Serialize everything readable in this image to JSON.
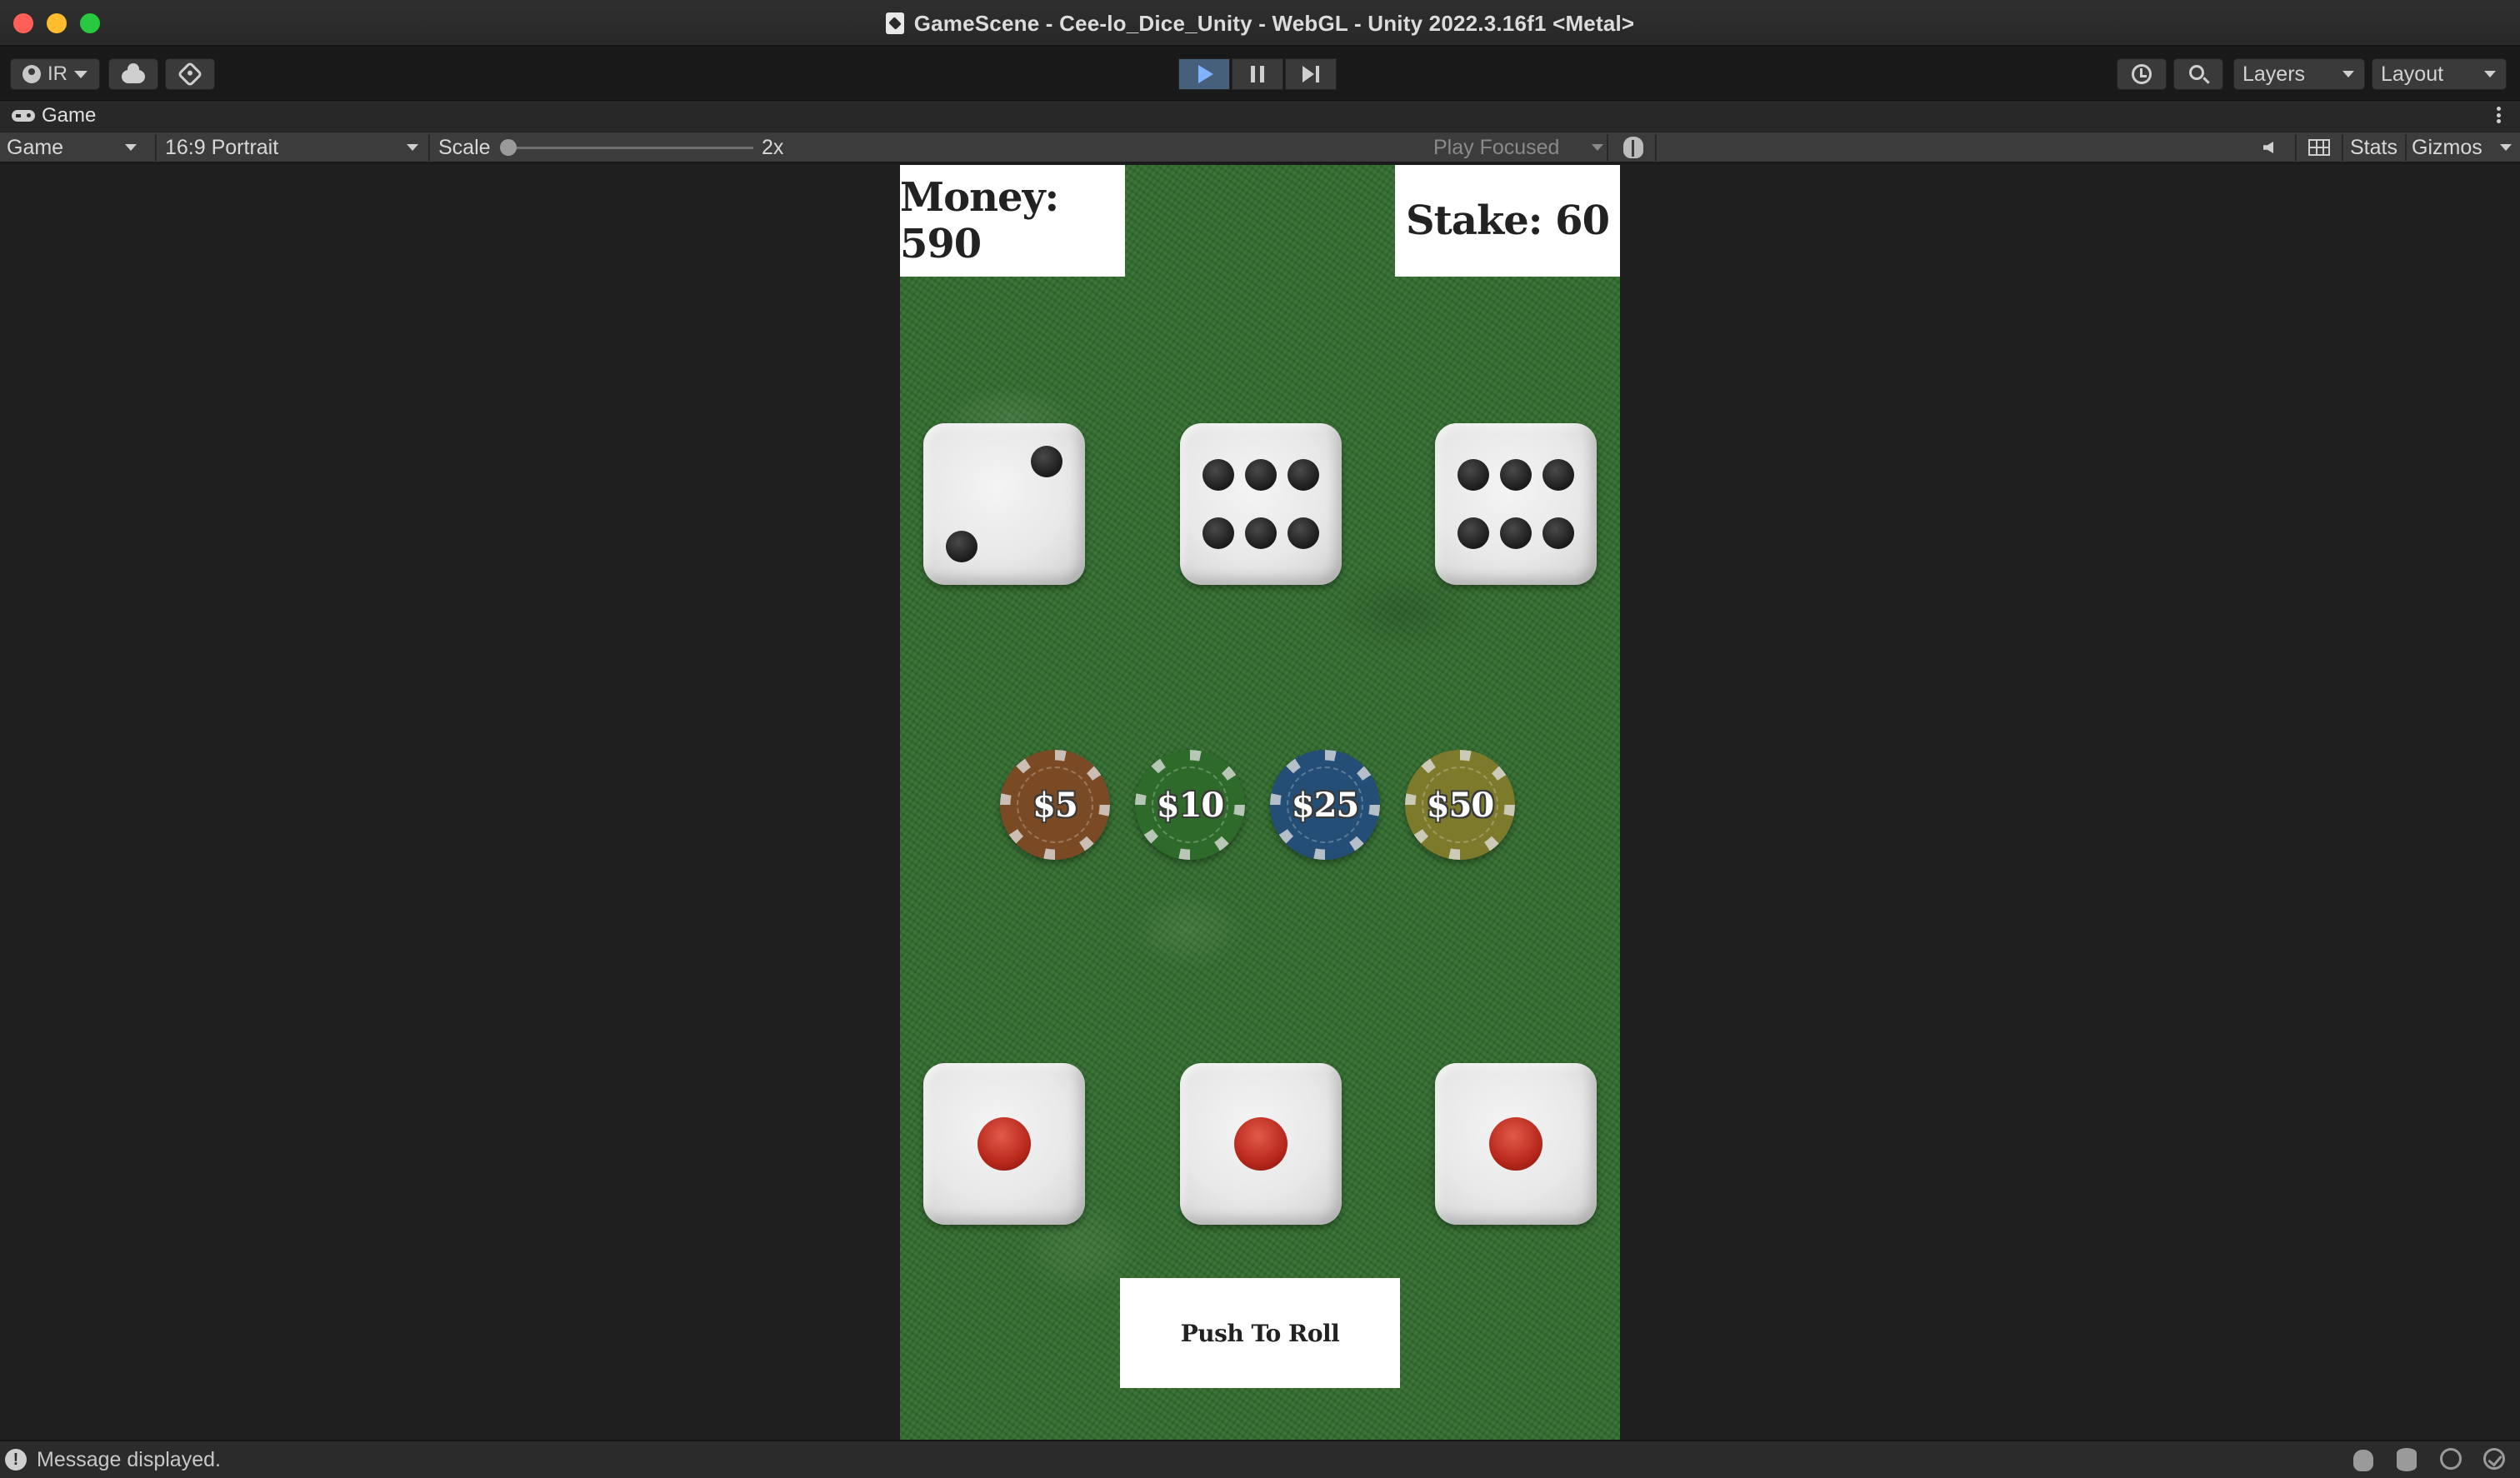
{
  "window": {
    "title": "GameScene - Cee-lo_Dice_Unity - WebGL - Unity 2022.3.16f1 <Metal>"
  },
  "toolbar": {
    "account_label": "IR",
    "layers_label": "Layers",
    "layout_label": "Layout",
    "play_active": true
  },
  "tab": {
    "label": "Game"
  },
  "game_view": {
    "display_label": "Game",
    "aspect_label": "16:9 Portrait",
    "scale_label": "Scale",
    "scale_value": "2x",
    "play_mode_label": "Play Focused",
    "stats_label": "Stats",
    "gizmos_label": "Gizmos"
  },
  "game": {
    "money_text": "Money: 590",
    "stake_text": "Stake: 60",
    "dealer_dice": [
      2,
      6,
      6
    ],
    "player_dice": [
      1,
      1,
      1
    ],
    "chips": [
      {
        "label": "$5",
        "color": "#7a4a25"
      },
      {
        "label": "$10",
        "color": "#2e6a2a"
      },
      {
        "label": "$25",
        "color": "#244e76"
      },
      {
        "label": "$50",
        "color": "#7e7a2c"
      }
    ],
    "roll_button_label": "Push To Roll"
  },
  "status": {
    "message": "Message displayed."
  }
}
